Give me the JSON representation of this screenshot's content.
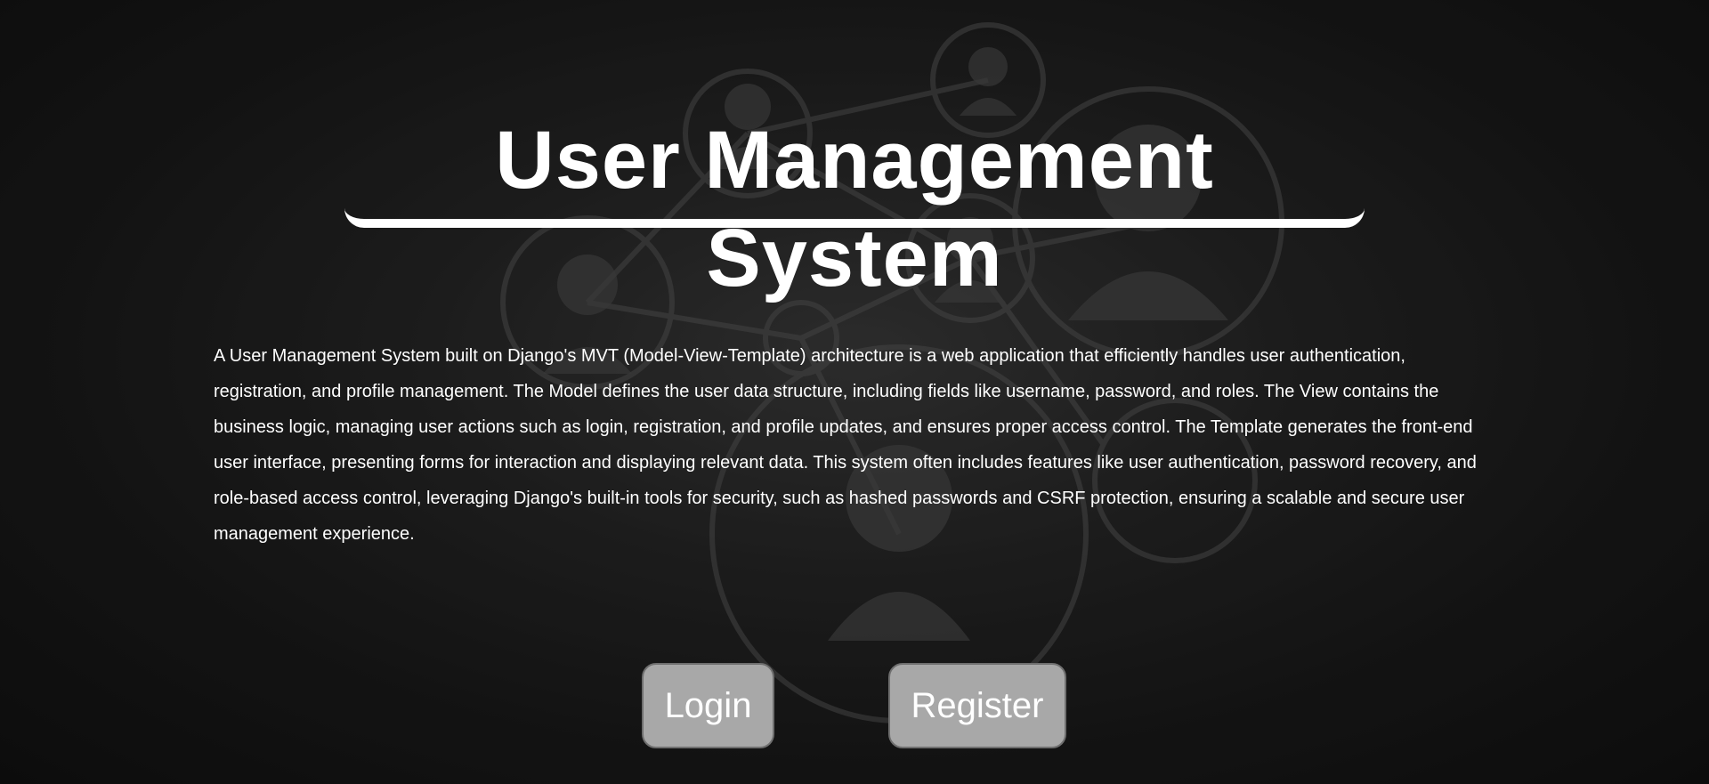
{
  "page": {
    "title": "User Management System",
    "description": "A User Management System built on Django's MVT (Model-View-Template) architecture is a web application that efficiently handles user authentication, registration, and profile management. The Model defines the user data structure, including fields like username, password, and roles. The View contains the business logic, managing user actions such as login, registration, and profile updates, and ensures proper access control. The Template generates the front-end user interface, presenting forms for interaction and displaying relevant data. This system often includes features like user authentication, password recovery, and role-based access control, leveraging Django's built-in tools for security, such as hashed passwords and CSRF protection, ensuring a scalable and secure user management experience."
  },
  "actions": {
    "login_label": "Login",
    "register_label": "Register"
  },
  "colors": {
    "button_bg": "#a8a8a8",
    "text": "#ffffff",
    "overlay": "#151515"
  }
}
